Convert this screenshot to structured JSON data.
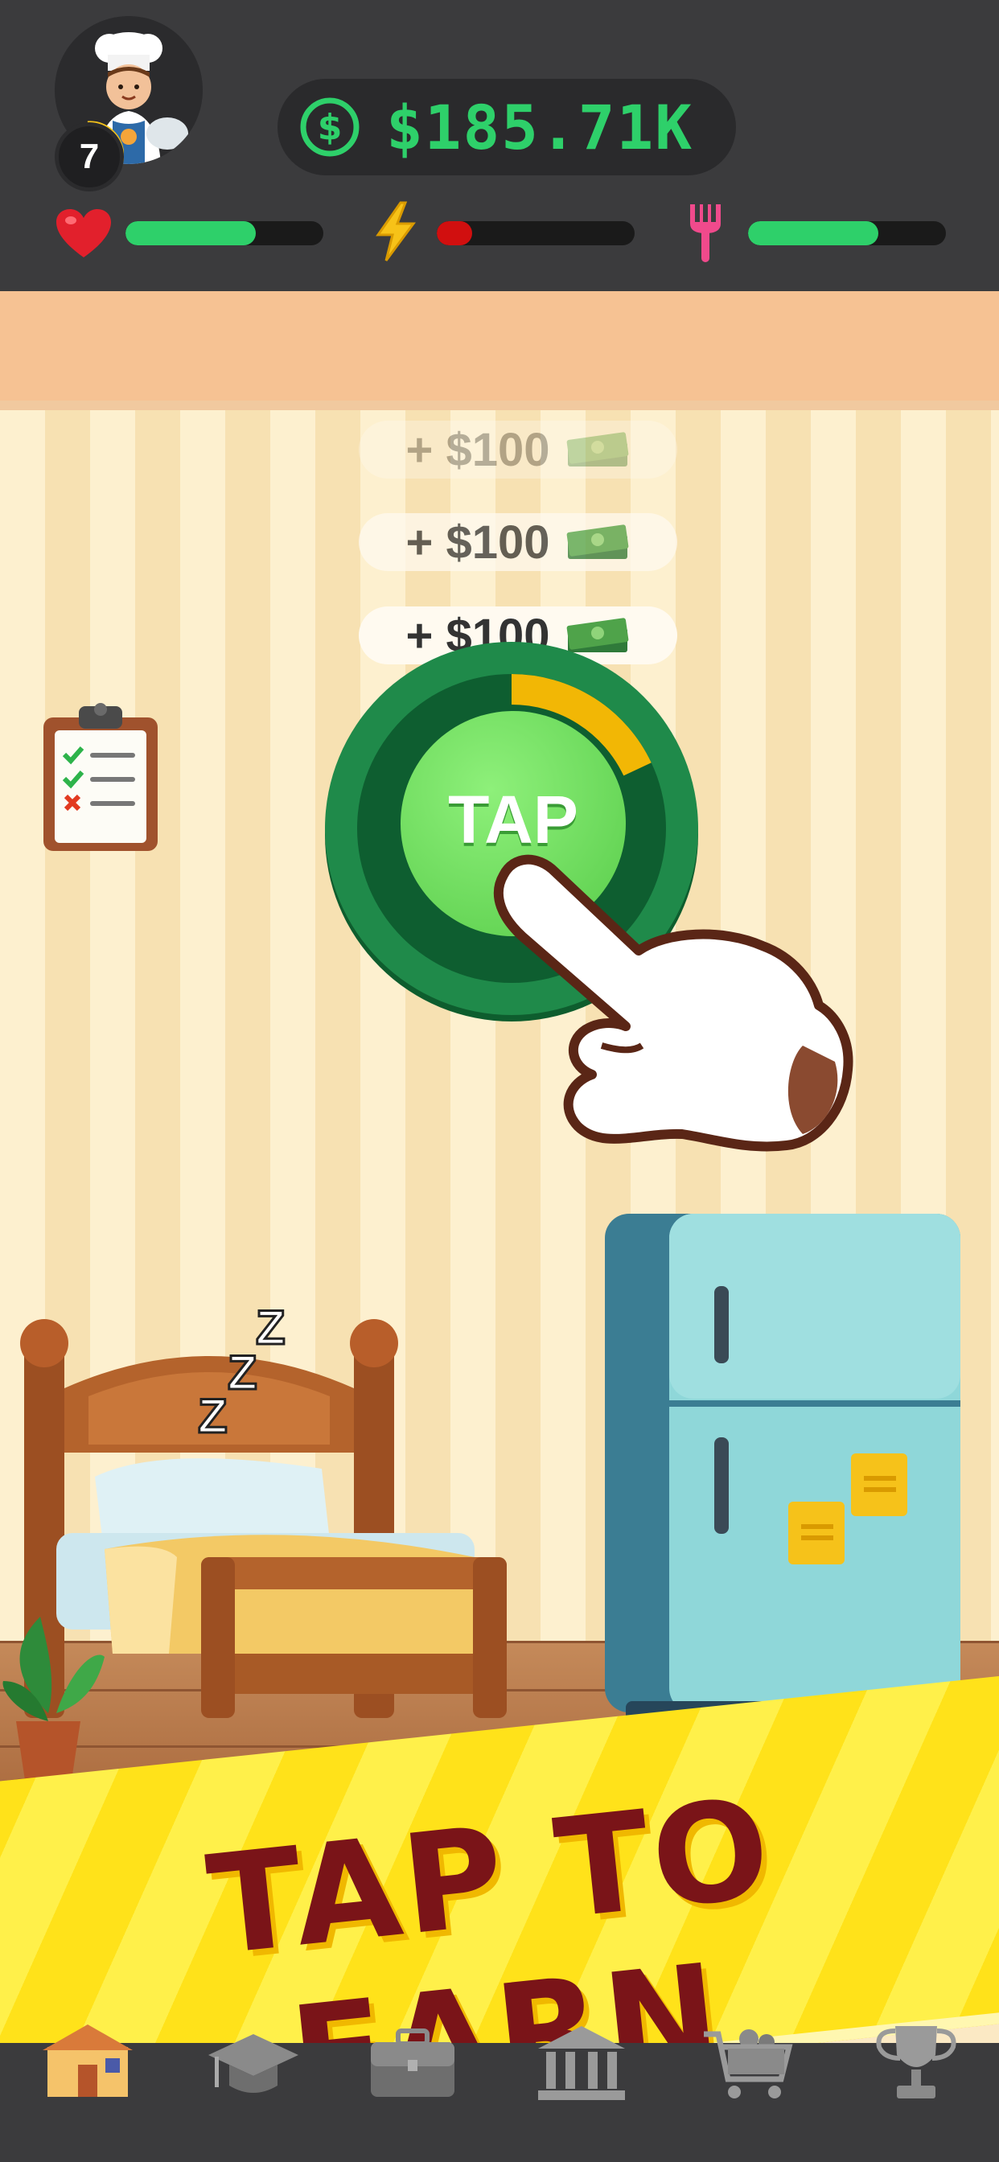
{
  "hud": {
    "level": "7",
    "money": "$185.71K",
    "stats": [
      {
        "name": "health",
        "icon": "heart-icon",
        "fill": 0.66,
        "color": "#2ed06a"
      },
      {
        "name": "energy",
        "icon": "lightning-icon",
        "fill": 0.18,
        "color": "#d10f0f"
      },
      {
        "name": "food",
        "icon": "fork-icon",
        "fill": 0.66,
        "color": "#2ed06a"
      }
    ]
  },
  "rewards": [
    {
      "label": "+ $100",
      "opacity": 0.35
    },
    {
      "label": "+ $100",
      "opacity": 0.75
    },
    {
      "label": "+ $100",
      "opacity": 1.0
    }
  ],
  "tap_button": {
    "label": "TAP",
    "progress": 0.18
  },
  "sleep_text": [
    "Z",
    "Z",
    "Z"
  ],
  "banner": {
    "text": "TAP TO EARN"
  },
  "nav": {
    "items": [
      {
        "name": "home",
        "icon": "house-icon"
      },
      {
        "name": "education",
        "icon": "graduation-cap-icon"
      },
      {
        "name": "work",
        "icon": "briefcase-icon"
      },
      {
        "name": "bank",
        "icon": "bank-icon"
      },
      {
        "name": "shop",
        "icon": "shopping-cart-icon"
      },
      {
        "name": "achievements",
        "icon": "trophy-icon"
      }
    ]
  },
  "colors": {
    "accent_green": "#2ed06a",
    "banner_yellow": "#ffe21a",
    "banner_text": "#7a1418"
  }
}
